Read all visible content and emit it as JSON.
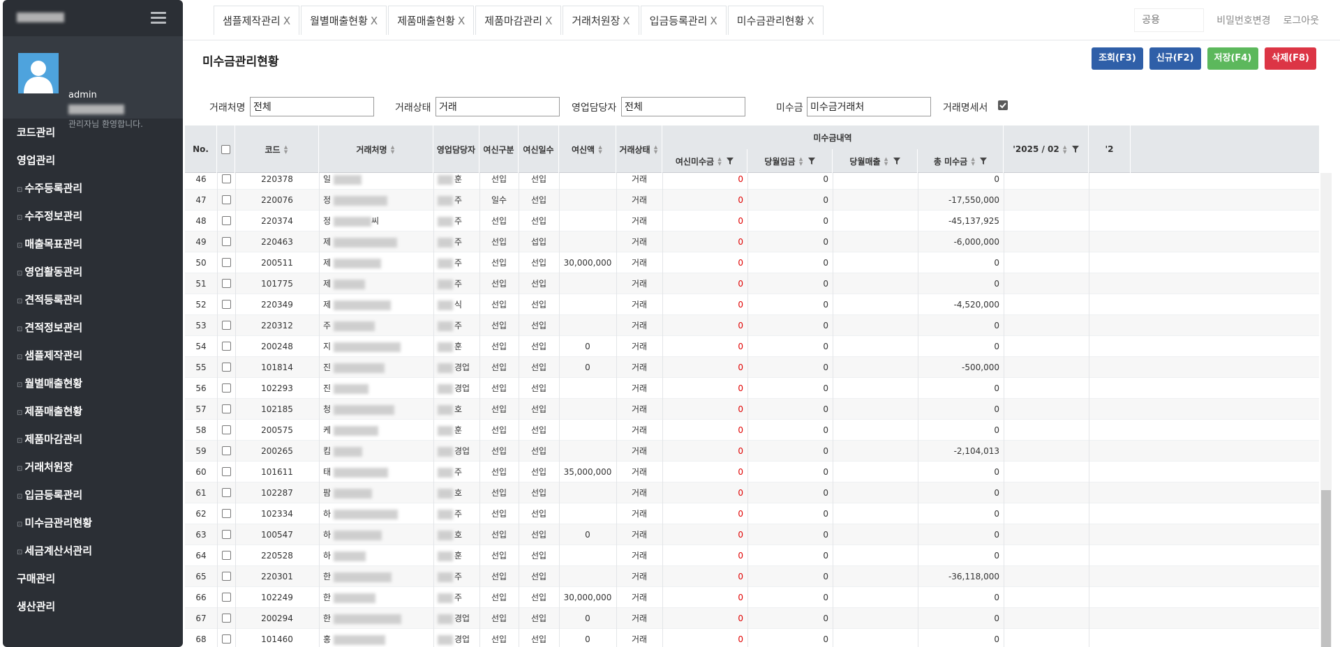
{
  "sidebar": {
    "user_name": "admin",
    "welcome": "관리자님 환영합니다.",
    "menu": [
      {
        "label": "코드관리",
        "sub": false
      },
      {
        "label": "영업관리",
        "sub": false
      },
      {
        "label": "수주등록관리",
        "sub": true
      },
      {
        "label": "수주정보관리",
        "sub": true
      },
      {
        "label": "매출목표관리",
        "sub": true
      },
      {
        "label": "영업활동관리",
        "sub": true
      },
      {
        "label": "견적등록관리",
        "sub": true
      },
      {
        "label": "견적정보관리",
        "sub": true
      },
      {
        "label": "샘플제작관리",
        "sub": true
      },
      {
        "label": "월별매출현황",
        "sub": true
      },
      {
        "label": "제품매출현황",
        "sub": true
      },
      {
        "label": "제품마감관리",
        "sub": true
      },
      {
        "label": "거래처원장",
        "sub": true
      },
      {
        "label": "입금등록관리",
        "sub": true
      },
      {
        "label": "미수금관리현황",
        "sub": true
      },
      {
        "label": "세금계산서관리",
        "sub": true
      },
      {
        "label": "구매관리",
        "sub": false
      },
      {
        "label": "생산관리",
        "sub": false
      }
    ]
  },
  "tabs": [
    "샘플제작관리",
    "월별매출현황",
    "제품매출현황",
    "제품마감관리",
    "거래처원장",
    "입금등록관리",
    "미수금관리현황"
  ],
  "tab_close": "X",
  "topbar": {
    "search_placeholder": "공용",
    "change_password": "비밀번호변경",
    "logout": "로그아웃"
  },
  "page_title": "미수금관리현황",
  "buttons": {
    "search": "조회(F3)",
    "new": "신규(F2)",
    "save": "저장(F4)",
    "delete": "삭제(F8)"
  },
  "colors": {
    "sidebar_bg": "#2b2f35",
    "btn_blue": "#2f5fa8",
    "btn_green": "#5cb85c",
    "btn_red": "#dc3545",
    "negative_red": "#e00000"
  },
  "filters": {
    "client_label": "거래처명",
    "client_value": "전체",
    "status_label": "거래상태",
    "status_value": "거래",
    "sales_rep_label": "영업담당자",
    "sales_rep_value": "전체",
    "receivable_label": "미수금",
    "receivable_value": "미수금거래처",
    "statement_label": "거래명세서",
    "statement_checked": true
  },
  "grid": {
    "headers": {
      "no": "No.",
      "code": "코드",
      "client": "거래처명",
      "rep": "영업담당자",
      "credit_type": "여신구분",
      "credit_days": "여신일수",
      "credit_amount": "여신액",
      "status": "거래상태",
      "group": "미수금내역",
      "credit_receivable": "여신미수금",
      "month_deposit": "당월입금",
      "month_sales": "당월매출",
      "total_receivable": "총 미수금",
      "period": "'2025 / 02",
      "next_period": "'2"
    },
    "rows": [
      {
        "no": "46",
        "code": "220378",
        "client": "일",
        "rep": "훈",
        "ctype": "선입",
        "cdays": "선입",
        "camt": "",
        "status": "거래",
        "crec": "0",
        "dep": "0",
        "sales": "",
        "total": "0"
      },
      {
        "no": "47",
        "code": "220076",
        "client": "정",
        "rep": "주",
        "ctype": "일수",
        "cdays": "선입",
        "camt": "",
        "status": "거래",
        "crec": "0",
        "dep": "0",
        "sales": "",
        "total": "-17,550,000"
      },
      {
        "no": "48",
        "code": "220374",
        "client": "정",
        "client_suffix": "씨",
        "rep": "주",
        "ctype": "선입",
        "cdays": "선입",
        "camt": "",
        "status": "거래",
        "crec": "0",
        "dep": "0",
        "sales": "",
        "total": "-45,137,925"
      },
      {
        "no": "49",
        "code": "220463",
        "client": "제",
        "rep": "주",
        "ctype": "선입",
        "cdays": "섭입",
        "camt": "",
        "status": "거래",
        "crec": "0",
        "dep": "0",
        "sales": "",
        "total": "-6,000,000"
      },
      {
        "no": "50",
        "code": "200511",
        "client": "제",
        "rep": "주",
        "ctype": "선입",
        "cdays": "선입",
        "camt": "30,000,000",
        "status": "거래",
        "crec": "0",
        "dep": "0",
        "sales": "",
        "total": "0"
      },
      {
        "no": "51",
        "code": "101775",
        "client": "제",
        "rep": "주",
        "ctype": "선입",
        "cdays": "선입",
        "camt": "",
        "status": "거래",
        "crec": "0",
        "dep": "0",
        "sales": "",
        "total": "0"
      },
      {
        "no": "52",
        "code": "220349",
        "client": "제",
        "rep": "식",
        "ctype": "선입",
        "cdays": "선입",
        "camt": "",
        "status": "거래",
        "crec": "0",
        "dep": "0",
        "sales": "",
        "total": "-4,520,000"
      },
      {
        "no": "53",
        "code": "220312",
        "client": "주",
        "rep": "주",
        "ctype": "선입",
        "cdays": "선입",
        "camt": "",
        "status": "거래",
        "crec": "0",
        "dep": "0",
        "sales": "",
        "total": "0"
      },
      {
        "no": "54",
        "code": "200248",
        "client": "지",
        "rep": "훈",
        "ctype": "선입",
        "cdays": "선입",
        "camt": "0",
        "status": "거래",
        "crec": "0",
        "dep": "0",
        "sales": "",
        "total": "0"
      },
      {
        "no": "55",
        "code": "101814",
        "client": "진",
        "rep": "경업",
        "ctype": "선입",
        "cdays": "선입",
        "camt": "0",
        "status": "거래",
        "crec": "0",
        "dep": "0",
        "sales": "",
        "total": "-500,000"
      },
      {
        "no": "56",
        "code": "102293",
        "client": "진",
        "rep": "경업",
        "ctype": "선입",
        "cdays": "선입",
        "camt": "",
        "status": "거래",
        "crec": "0",
        "dep": "0",
        "sales": "",
        "total": "0"
      },
      {
        "no": "57",
        "code": "102185",
        "client": "청",
        "rep": "호",
        "ctype": "선입",
        "cdays": "선입",
        "camt": "",
        "status": "거래",
        "crec": "0",
        "dep": "0",
        "sales": "",
        "total": "0"
      },
      {
        "no": "58",
        "code": "200575",
        "client": "케",
        "rep": "훈",
        "ctype": "선입",
        "cdays": "선입",
        "camt": "",
        "status": "거래",
        "crec": "0",
        "dep": "0",
        "sales": "",
        "total": "0"
      },
      {
        "no": "59",
        "code": "200265",
        "client": "킴",
        "rep": "경업",
        "ctype": "선입",
        "cdays": "선입",
        "camt": "",
        "status": "거래",
        "crec": "0",
        "dep": "0",
        "sales": "",
        "total": "-2,104,013"
      },
      {
        "no": "60",
        "code": "101611",
        "client": "태",
        "rep": "주",
        "ctype": "선입",
        "cdays": "선입",
        "camt": "35,000,000",
        "status": "거래",
        "crec": "0",
        "dep": "0",
        "sales": "",
        "total": "0"
      },
      {
        "no": "61",
        "code": "102287",
        "client": "팜",
        "rep": "호",
        "ctype": "선입",
        "cdays": "선입",
        "camt": "",
        "status": "거래",
        "crec": "0",
        "dep": "0",
        "sales": "",
        "total": "0"
      },
      {
        "no": "62",
        "code": "102334",
        "client": "하",
        "rep": "주",
        "ctype": "선입",
        "cdays": "선입",
        "camt": "",
        "status": "거래",
        "crec": "0",
        "dep": "0",
        "sales": "",
        "total": "0"
      },
      {
        "no": "63",
        "code": "100547",
        "client": "하",
        "rep": "호",
        "ctype": "선입",
        "cdays": "선입",
        "camt": "0",
        "status": "거래",
        "crec": "0",
        "dep": "0",
        "sales": "",
        "total": "0"
      },
      {
        "no": "64",
        "code": "220528",
        "client": "하",
        "rep": "훈",
        "ctype": "선입",
        "cdays": "선입",
        "camt": "",
        "status": "거래",
        "crec": "0",
        "dep": "0",
        "sales": "",
        "total": "0"
      },
      {
        "no": "65",
        "code": "220301",
        "client": "한",
        "rep": "주",
        "ctype": "선입",
        "cdays": "선입",
        "camt": "",
        "status": "거래",
        "crec": "0",
        "dep": "0",
        "sales": "",
        "total": "-36,118,000"
      },
      {
        "no": "66",
        "code": "102249",
        "client": "한",
        "rep": "주",
        "ctype": "선입",
        "cdays": "선입",
        "camt": "30,000,000",
        "status": "거래",
        "crec": "0",
        "dep": "0",
        "sales": "",
        "total": "0"
      },
      {
        "no": "67",
        "code": "200294",
        "client": "한",
        "rep": "경업",
        "ctype": "선입",
        "cdays": "선입",
        "camt": "0",
        "status": "거래",
        "crec": "0",
        "dep": "0",
        "sales": "",
        "total": "0"
      },
      {
        "no": "68",
        "code": "101460",
        "client": "홍",
        "rep": "경업",
        "ctype": "선입",
        "cdays": "선입",
        "camt": "0",
        "status": "거래",
        "crec": "0",
        "dep": "0",
        "sales": "",
        "total": "0"
      }
    ]
  }
}
